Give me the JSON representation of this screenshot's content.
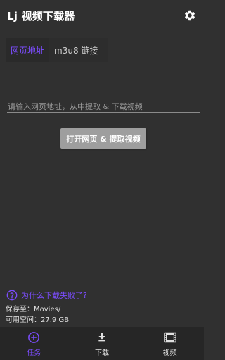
{
  "appbar": {
    "title": "Lj 视频下载器",
    "settings_icon": "gear-icon"
  },
  "tabs": [
    {
      "label": "网页地址",
      "active": true
    },
    {
      "label": "m3u8 链接",
      "active": false
    }
  ],
  "url_input": {
    "placeholder": "请输入网页地址，从中提取 & 下载视频",
    "value": ""
  },
  "open_button": {
    "label": "打开网页 & 提取视频"
  },
  "help": {
    "text": "为什么下载失败了?",
    "icon": "help-circle-icon"
  },
  "storage": {
    "save_to": "保存至：Movies/",
    "free_space": "可用空间：27.9 GB"
  },
  "bottom_nav": [
    {
      "label": "任务",
      "icon": "add-circle-icon",
      "active": true
    },
    {
      "label": "下载",
      "icon": "download-icon",
      "active": false
    },
    {
      "label": "视频",
      "icon": "film-icon",
      "active": false
    }
  ],
  "colors": {
    "accent": "#7c4dff",
    "background": "#303030",
    "nav_background": "#262626",
    "button": "#9e9e9e"
  }
}
